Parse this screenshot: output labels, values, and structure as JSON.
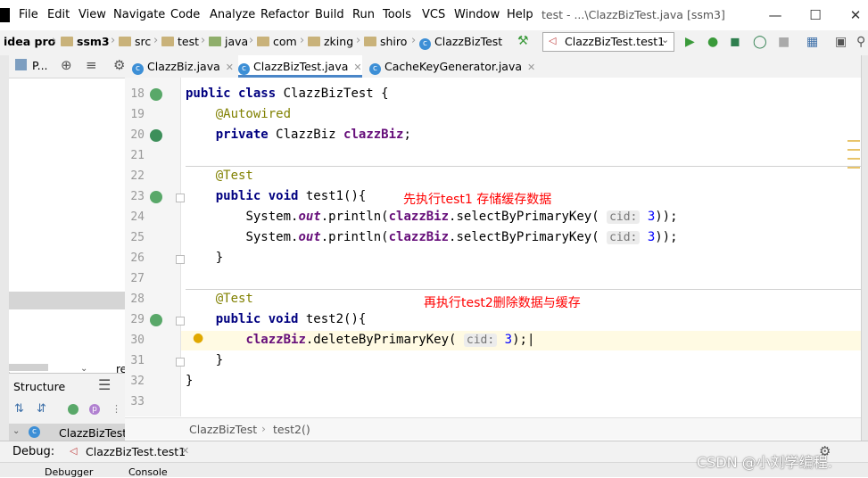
{
  "menu": [
    "File",
    "Edit",
    "View",
    "Navigate",
    "Code",
    "Analyze",
    "Refactor",
    "Build",
    "Run",
    "Tools",
    "VCS",
    "Window",
    "Help"
  ],
  "window_title": "test - ...\\ClazzBizTest.java [ssm3]",
  "breadcrumbs": [
    "idea pro",
    "ssm3",
    "src",
    "test",
    "java",
    "com",
    "zking",
    "shiro",
    "ClazzBizTest"
  ],
  "run_config": "ClazzBizTest.test1",
  "project_panel_label": "P...",
  "project_tree_item": "re",
  "structure_title": "Structure",
  "structure_item": "ClazzBizTest",
  "tabs": [
    {
      "label": "ClazzBiz.java",
      "active": false
    },
    {
      "label": "ClazzBizTest.java",
      "active": true
    },
    {
      "label": "CacheKeyGenerator.java",
      "active": false
    }
  ],
  "line_numbers": [
    "18",
    "19",
    "20",
    "21",
    "22",
    "23",
    "24",
    "25",
    "26",
    "27",
    "28",
    "29",
    "30",
    "31",
    "32",
    "33"
  ],
  "code": {
    "l18_kw": "public class",
    "l18_rest": " ClazzBizTest {",
    "l19": "@Autowired",
    "l20_kw": "private",
    "l20_type": " ClazzBiz ",
    "l20_field": "clazzBiz",
    "semi": ";",
    "l22": "@Test",
    "l23_kw": "public void",
    "l23_rest": " test1(){",
    "sys": "System.",
    "out": "out",
    "println": ".println(",
    "field": "clazzBiz",
    "select": ".selectByPrimaryKey(",
    "hint": "cid:",
    "num": "3",
    "close2": "));",
    "brace_close": "}",
    "l28": "@Test",
    "l29_kw": "public void",
    "l29_rest": " test2(){",
    "delete": ".deleteByPrimaryKey(",
    "close1": ");",
    "cursor": "|"
  },
  "comments": {
    "first": "先执行test1 存储缓存数据",
    "second": "再执行test2删除数据与缓存"
  },
  "editor_breadcrumb": [
    "ClazzBizTest",
    "test2()"
  ],
  "debug_label": "Debug:",
  "debug_tab": "ClazzBizTest.test1",
  "bottom_tabs": [
    "Debugger",
    "Console"
  ],
  "watermark": "CSDN @小刘学编程."
}
